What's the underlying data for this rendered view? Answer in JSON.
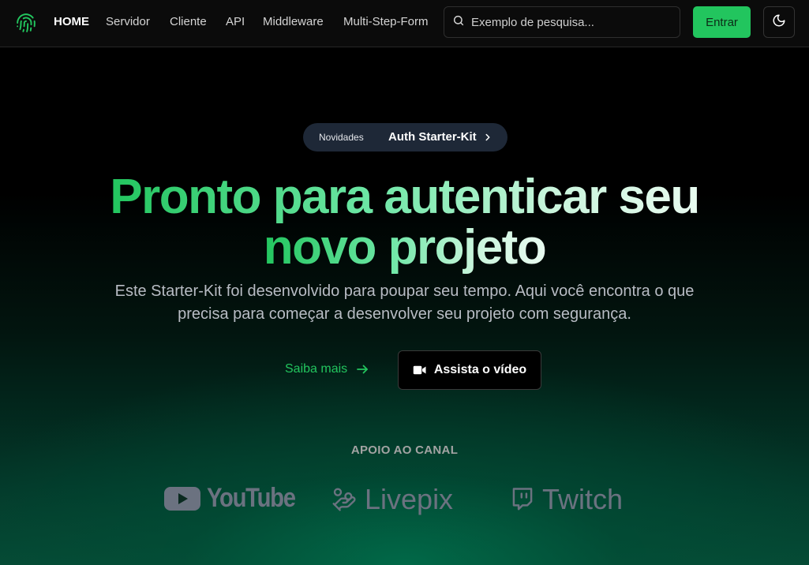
{
  "nav": {
    "links": [
      {
        "label": "HOME",
        "active": true
      },
      {
        "label": "Servidor"
      },
      {
        "label": "Cliente"
      },
      {
        "label": "API"
      },
      {
        "label": "Middleware"
      },
      {
        "label": "Multi-Step-Form"
      }
    ],
    "search_placeholder": "Exemplo de pesquisa...",
    "enter_label": "Entrar"
  },
  "badge": {
    "tag": "Novidades",
    "title": "Auth Starter-Kit"
  },
  "hero": {
    "title_line1": "Pronto para autenticar seu",
    "title_line2": "novo projeto",
    "subtitle": "Este Starter-Kit foi desenvolvido para poupar seu tempo. Aqui você encontra o que precisa para começar a desenvolver seu projeto com segurança.",
    "more_label": "Saiba mais",
    "video_label": "Assista o vídeo"
  },
  "support": {
    "title": "APOIO AO CANAL",
    "partners": [
      "YouTube",
      "Livepix",
      "Twitch"
    ]
  },
  "colors": {
    "accent": "#22c55e",
    "nav_bg": "#0b0b0b",
    "badge_bg": "#1e2837",
    "muted": "#6b7280"
  }
}
